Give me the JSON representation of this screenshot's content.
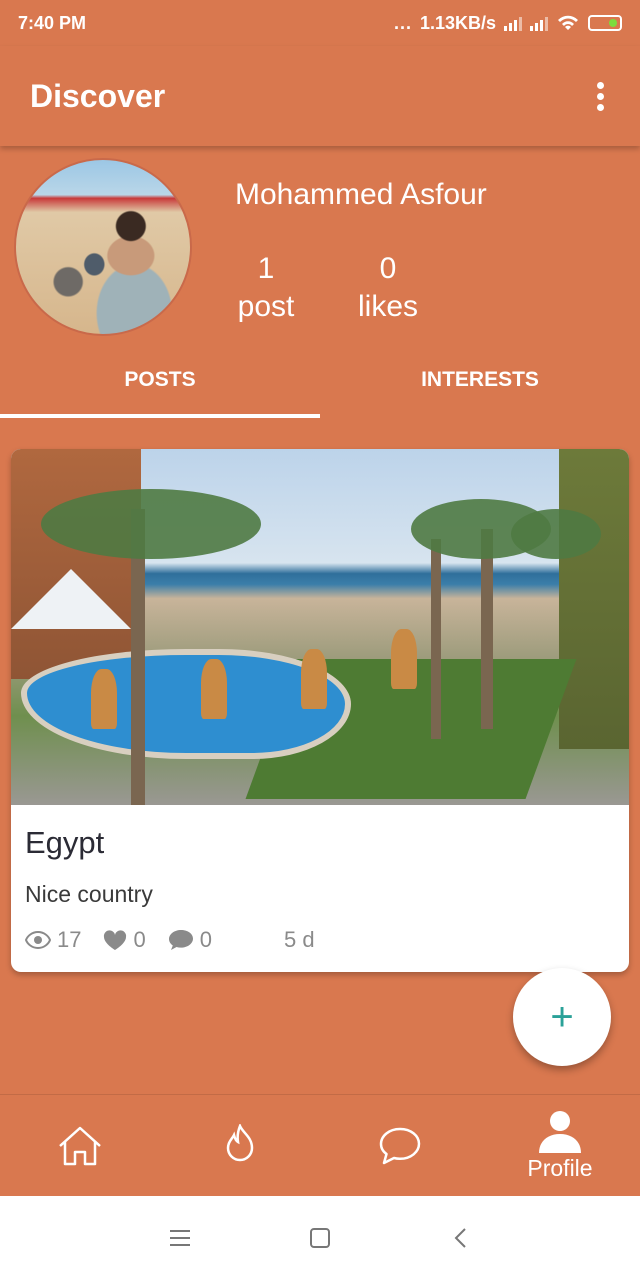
{
  "status_bar": {
    "time": "7:40 PM",
    "dots": "...",
    "speed": "1.13KB/s",
    "icons": [
      "signal-icon",
      "signal-icon",
      "wifi-icon",
      "battery-icon"
    ]
  },
  "appbar": {
    "title": "Discover",
    "menu_icon": "more-vertical-icon"
  },
  "profile": {
    "name": "Mohammed Asfour",
    "posts_count": "1",
    "posts_label": "post",
    "likes_count": "0",
    "likes_label": "likes"
  },
  "tabs": [
    {
      "label": "POSTS",
      "active": true
    },
    {
      "label": "INTERESTS",
      "active": false
    }
  ],
  "post": {
    "title": "Egypt",
    "description": "Nice country",
    "views": "17",
    "likes": "0",
    "comments": "0",
    "age": "5 d"
  },
  "fab": {
    "icon": "plus-icon",
    "symbol": "+"
  },
  "bottom_nav": [
    {
      "icon": "home-icon",
      "label": ""
    },
    {
      "icon": "fire-icon",
      "label": ""
    },
    {
      "icon": "chat-icon",
      "label": ""
    },
    {
      "icon": "user-icon",
      "label": "Profile"
    }
  ],
  "colors": {
    "primary": "#D9784F",
    "fab_plus": "#2aa198",
    "card_bg": "#ffffff"
  }
}
